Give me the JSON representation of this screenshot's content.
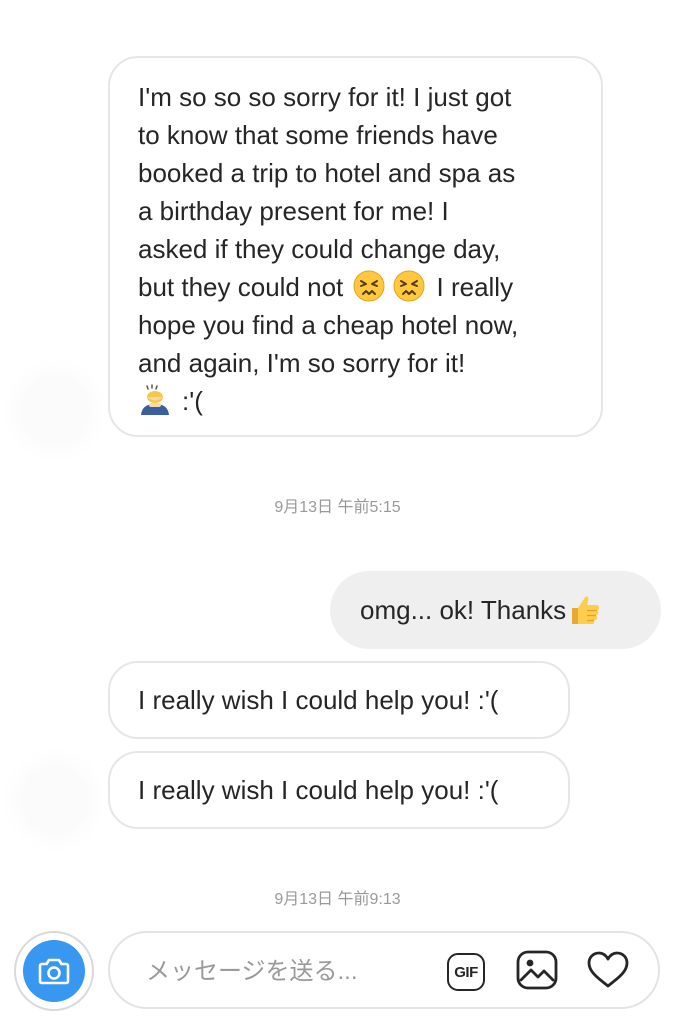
{
  "thread": {
    "messages": [
      {
        "lines": [
          "I'm so so so sorry for it! I just got",
          "to know that some friends have",
          "booked a trip to hotel and spa as",
          "a birthday present for me! I",
          "asked if they could change day,",
          "but they could not",
          "I really",
          "hope you find a cheap hotel now,",
          "and again, I'm so sorry for it!",
          ":'("
        ],
        "emojis": [
          "confounded-face",
          "confounded-face",
          "bowing-person"
        ]
      }
    ],
    "timestamp_1": "9月13日 午前5:15",
    "outgoing": {
      "text": "omg... ok! Thanks",
      "emoji": "thumbs-up"
    },
    "reply_1": "I really wish I could help you! :'(",
    "reply_2": "I really wish I could help you!  :'(",
    "timestamp_2": "9月13日 午前9:13"
  },
  "composer": {
    "placeholder": "メッセージを送る...",
    "gif_label": "GIF",
    "icons": [
      "camera-icon",
      "gif-icon",
      "photo-icon",
      "heart-icon"
    ]
  },
  "colors": {
    "accent": "#3897f0",
    "incoming_border": "#e6e6e6",
    "outgoing_bg": "#efefef",
    "timestamp": "#999999",
    "text": "#262626"
  }
}
